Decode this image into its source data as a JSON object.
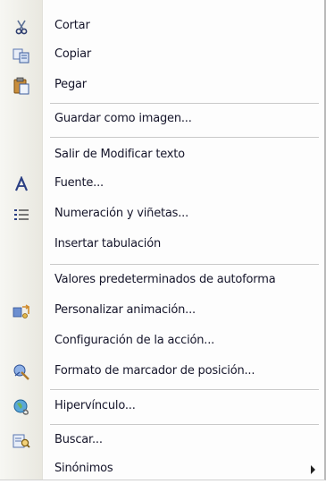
{
  "menu": {
    "items": [
      {
        "label": "Cortar",
        "icon": "scissors-icon"
      },
      {
        "label": "Copiar",
        "icon": "copy-icon"
      },
      {
        "label": "Pegar",
        "icon": "paste-icon"
      },
      {
        "label": "Guardar como imagen...",
        "icon": ""
      },
      {
        "label": "Salir de Modificar texto",
        "icon": ""
      },
      {
        "label": "Fuente...",
        "icon": "font-icon"
      },
      {
        "label": "Numeración y viñetas...",
        "icon": "bullets-icon"
      },
      {
        "label": "Insertar tabulación",
        "icon": ""
      },
      {
        "label": "Valores predeterminados de autoforma",
        "icon": ""
      },
      {
        "label": "Personalizar animación...",
        "icon": "animation-icon"
      },
      {
        "label": "Configuración de la acción...",
        "icon": ""
      },
      {
        "label": "Formato de marcador de posición...",
        "icon": "placeholder-format-icon"
      },
      {
        "label": "Hipervínculo...",
        "icon": "hyperlink-icon"
      },
      {
        "label": "Buscar...",
        "icon": "search-icon"
      },
      {
        "label": "Sinónimos",
        "icon": "",
        "submenu_arrow": "submenu-arrow-icon"
      }
    ]
  }
}
